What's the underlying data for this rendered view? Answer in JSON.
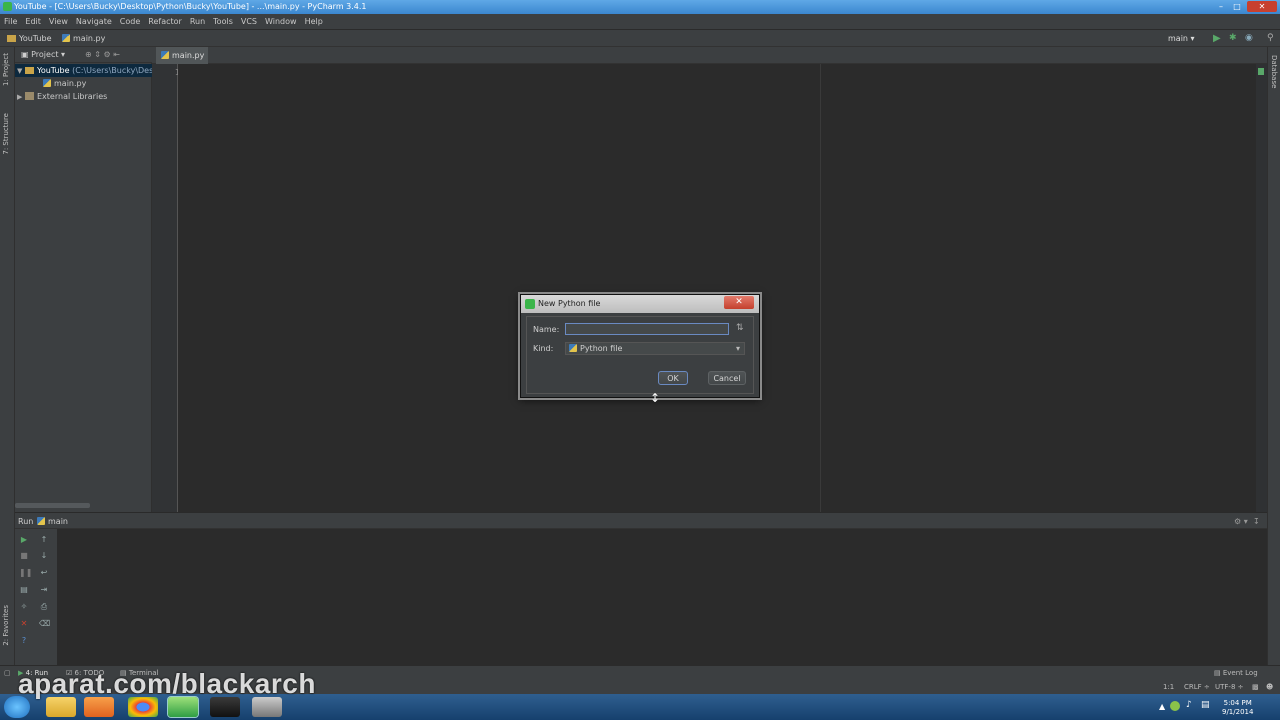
{
  "window": {
    "title": "YouTube - [C:\\Users\\Bucky\\Desktop\\Python\\Bucky\\YouTube] - ...\\main.py - PyCharm 3.4.1"
  },
  "menu": [
    "File",
    "Edit",
    "View",
    "Navigate",
    "Code",
    "Refactor",
    "Run",
    "Tools",
    "VCS",
    "Window",
    "Help"
  ],
  "navbar": {
    "project": "YouTube",
    "file": "main.py",
    "run_config": "main"
  },
  "project_panel": {
    "header": "Project",
    "root_name": "YouTube",
    "root_path": "(C:\\Users\\Bucky\\Des",
    "file": "main.py",
    "external": "External Libraries"
  },
  "left_stripe": {
    "project_tab": "1: Project",
    "structure_tab": "7: Structure",
    "favorites_tab": "2: Favorites"
  },
  "right_stripe": {
    "database_tab": "Database"
  },
  "editor": {
    "tab": "main.py",
    "line_number": "1"
  },
  "run_panel": {
    "label": "Run",
    "config": "main"
  },
  "bottom_tabs": {
    "run": "4: Run",
    "todo": "6: TODO",
    "terminal": "Terminal",
    "event_log": "Event Log"
  },
  "status": {
    "position": "1:1",
    "line_sep": "CRLF",
    "encoding": "UTF-8"
  },
  "taskbar": {
    "time": "5:04 PM",
    "date": "9/1/2014"
  },
  "watermark": "aparat.com/blackarch",
  "dialog": {
    "title": "New Python file",
    "name_label": "Name:",
    "name_value": "",
    "kind_label": "Kind:",
    "kind_value": "Python file",
    "ok": "OK",
    "cancel": "Cancel"
  },
  "colors": {
    "background": "#2b2b2b",
    "panel": "#3c3f41",
    "selection": "#0d293e",
    "run_green": "#59a869"
  }
}
